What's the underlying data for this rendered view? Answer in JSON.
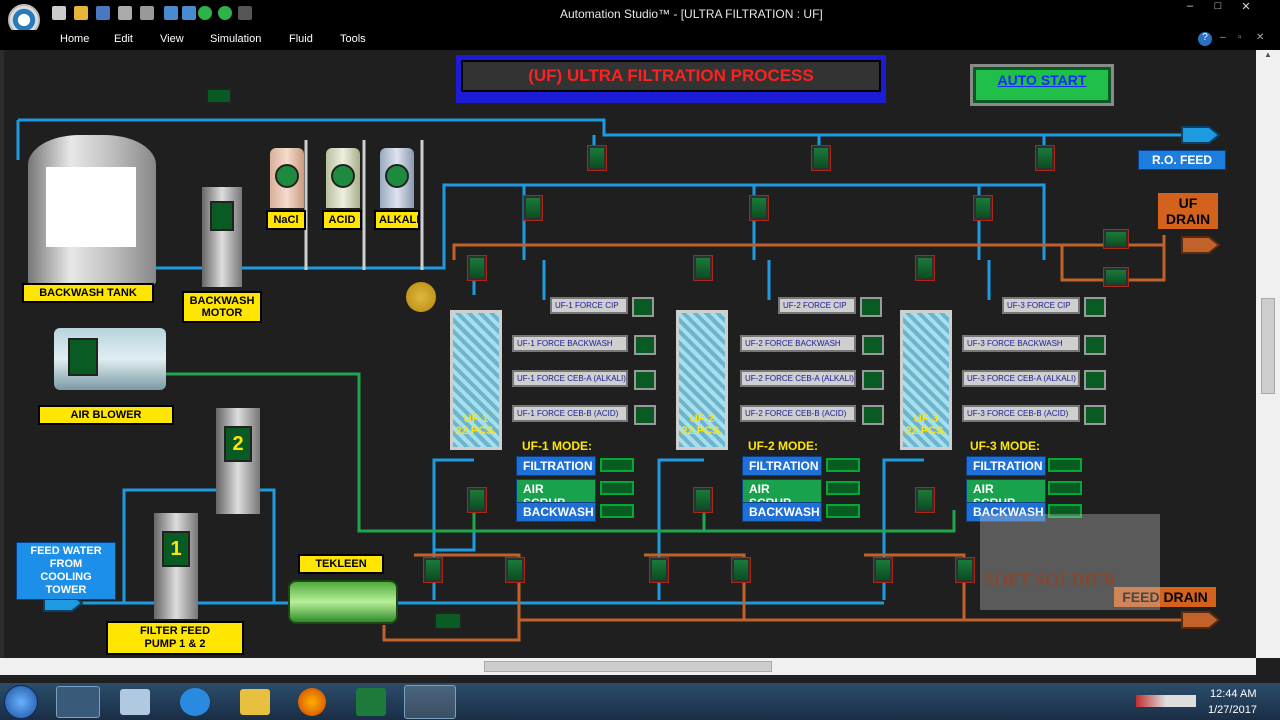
{
  "window": {
    "title": "Automation Studio™ - [ULTRA FILTRATION : UF]"
  },
  "menu": [
    "Home",
    "Edit",
    "View",
    "Simulation",
    "Fluid",
    "Tools"
  ],
  "panel": {
    "title": "(UF) ULTRA FILTRATION PROCESS",
    "auto_start": "AUTO START"
  },
  "equipment": {
    "backwash_tank": "BACKWASH TANK",
    "backwash_motor_line1": "BACKWASH",
    "backwash_motor_line2": "MOTOR",
    "air_blower": "AIR BLOWER",
    "nacl": "NaCl",
    "acid": "ACID",
    "alkali": "ALKALI",
    "tekleen": "TEKLEEN",
    "feed_water_line1": "FEED WATER",
    "feed_water_line2": "FROM",
    "feed_water_line3": "COOLING TOWER",
    "filter_feed_line1": "FILTER FEED",
    "filter_feed_line2": "PUMP 1 & 2",
    "pump1": "1",
    "pump2": "2",
    "ro_feed": "R.O. FEED",
    "uf_drain_line1": "UF",
    "uf_drain_line2": "DRAIN",
    "feed_drain": "FEED DRAIN"
  },
  "units": [
    {
      "name": "UF-1",
      "pcs": "22 PCS.",
      "mode_title": "UF-1 MODE:",
      "force_cip": "UF-1 FORCE CIP",
      "force_backwash": "UF-1 FORCE BACKWASH",
      "force_ceb_a": "UF-1 FORCE CEB-A (ALKALI)",
      "force_ceb_b": "UF-1 FORCE CEB-B (ACID)"
    },
    {
      "name": "UF-2",
      "pcs": "22 PCS.",
      "mode_title": "UF-2 MODE:",
      "force_cip": "UF-2 FORCE CIP",
      "force_backwash": "UF-2 FORCE BACKWASH",
      "force_ceb_a": "UF-2 FORCE CEB-A (ALKALI)",
      "force_ceb_b": "UF-2 FORCE CEB-B (ACID)"
    },
    {
      "name": "UF-3",
      "pcs": "22 PCS.",
      "mode_title": "UF-3 MODE:",
      "force_cip": "UF-3 FORCE CIP",
      "force_backwash": "UF-3 FORCE BACKWASH",
      "force_ceb_a": "UF-3 FORCE CEB-A (ALKALI)",
      "force_ceb_b": "UF-3 FORCE CEB-B (ACID)"
    }
  ],
  "modes": {
    "filtration": "FILTRATION",
    "air_scrub": "AIR SCRUB",
    "backwash": "BACKWASH"
  },
  "watermark": "SOFT SOLDIER",
  "clock": {
    "time": "12:44 AM",
    "date": "1/27/2017"
  },
  "colors": {
    "water": "#1e9be0",
    "drain": "#c0622a",
    "air": "#1ea54e",
    "panel_title": "#ff2020"
  }
}
